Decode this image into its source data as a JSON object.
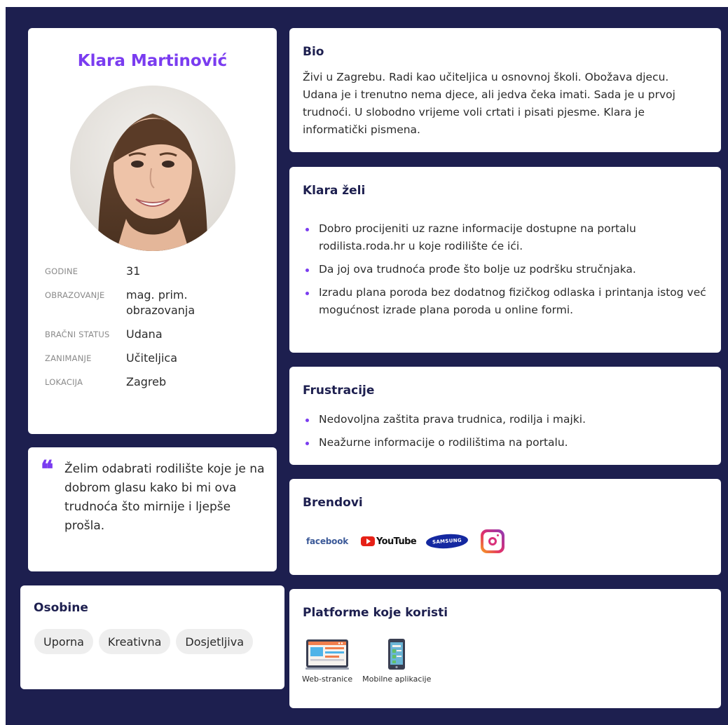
{
  "persona": {
    "name": "Klara Martinović",
    "attributes": [
      {
        "key": "GODINE",
        "value": "31"
      },
      {
        "key": "OBRAZOVANJE",
        "value": "mag. prim. obrazovanja"
      },
      {
        "key": "BRAČNI STATUS",
        "value": "Udana"
      },
      {
        "key": "ZANIMANJE",
        "value": "Učiteljica"
      },
      {
        "key": "LOKACIJA",
        "value": "Zagreb"
      }
    ]
  },
  "quote": {
    "mark": "❝",
    "text": "Želim odabrati rodilište koje je na dobrom glasu kako bi mi ova trudnoća što mirnije i ljepše prošla."
  },
  "traits": {
    "title": "Osobine",
    "items": [
      "Uporna",
      "Kreativna",
      "Dosjetljiva"
    ]
  },
  "bio": {
    "title": "Bio",
    "text": "Živi u Zagrebu. Radi kao učiteljica u osnovnoj školi. Obožava djecu. Udana je i trenutno nema djece, ali jedva čeka imati. Sada je u prvoj trudnoći. U slobodno vrijeme voli crtati i pisati pjesme. Klara je informatički pismena."
  },
  "wants": {
    "title": "Klara želi",
    "items": [
      "Dobro procijeniti uz razne informacije dostupne na portalu rodilista.roda.hr u koje rodilište će ići.",
      "Da joj ova trudnoća prođe što bolje uz podršku stručnjaka.",
      "Izradu plana poroda bez dodatnog fizičkog odlaska i printanja istog već mogućnost izrade plana poroda u online formi."
    ]
  },
  "frustrations": {
    "title": "Frustracije",
    "items": [
      "Nedovoljna zaštita prava trudnica, rodilja i majki.",
      "Neažurne informacije o rodilištima na portalu."
    ]
  },
  "brands": {
    "title": "Brendovi",
    "facebook": "facebook",
    "youtube": "YouTube",
    "samsung": "SAMSUNG"
  },
  "platforms": {
    "title": "Platforme koje koristi",
    "items": [
      {
        "label": "Web-stranice",
        "icon": "web-browser-icon"
      },
      {
        "label": "Mobilne aplikacije",
        "icon": "mobile-phone-icon"
      }
    ]
  },
  "colors": {
    "background": "#1d1f4f",
    "accent": "#7a3cf0",
    "card": "#ffffff"
  }
}
